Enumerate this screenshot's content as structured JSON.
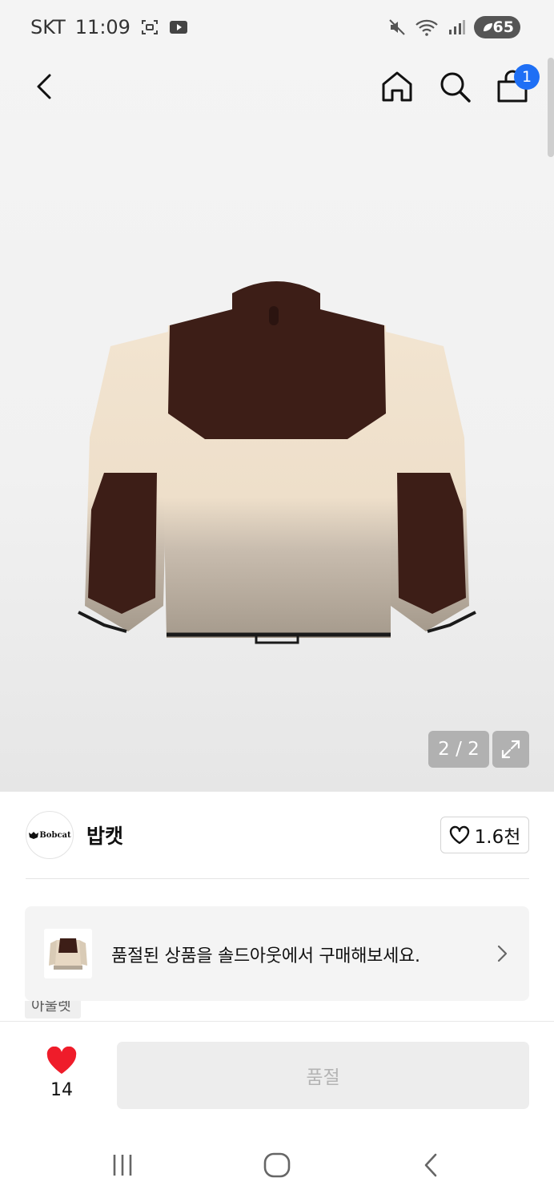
{
  "status_bar": {
    "carrier": "SKT",
    "time": "11:09",
    "battery": "65",
    "icons": [
      "screenshot-icon",
      "youtube-icon",
      "mute-icon",
      "wifi-icon",
      "signal-icon"
    ]
  },
  "top_nav": {
    "icons": [
      "back-icon",
      "home-icon",
      "search-icon",
      "cart-icon"
    ],
    "cart_count": "1"
  },
  "gallery": {
    "counter": "2 / 2",
    "zoom_icon": "expand-icon"
  },
  "brand": {
    "logo_text": "Bobcat",
    "name": "밥캣",
    "follow_count": "1.6천",
    "heart_icon": "heart-outline-icon"
  },
  "soldout_banner": {
    "text": "품절된 상품을 솔드아웃에서 구매해보세요.",
    "chevron_icon": "chevron-right-icon"
  },
  "tag_chip": "아울렛",
  "bottom_bar": {
    "like_icon": "heart-filled-icon",
    "like_count": "14",
    "soldout_label": "품절"
  },
  "system_nav": [
    "recents-icon",
    "home-circle-icon",
    "back-chevron-icon"
  ],
  "colors": {
    "accent_blue": "#1e6ff5",
    "like_red": "#ef1c2a",
    "jacket_brown": "#3d1e17",
    "fleece_cream": "#f1e3cf"
  }
}
